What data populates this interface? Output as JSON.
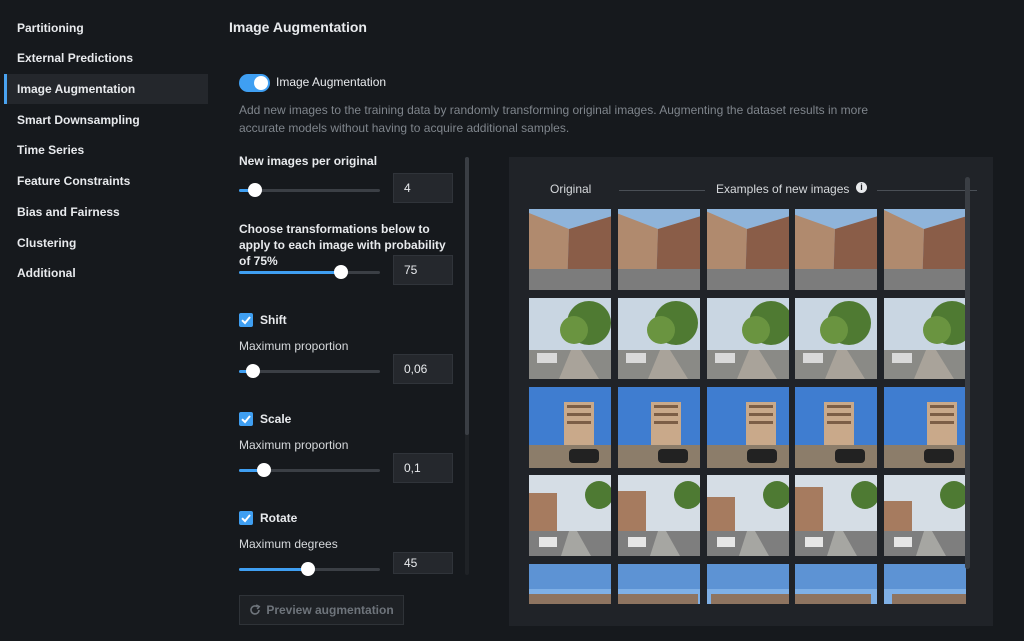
{
  "sidebar": {
    "items": [
      {
        "label": "Partitioning"
      },
      {
        "label": "External Predictions"
      },
      {
        "label": "Image Augmentation",
        "active": true
      },
      {
        "label": "Smart Downsampling"
      },
      {
        "label": "Time Series"
      },
      {
        "label": "Feature Constraints"
      },
      {
        "label": "Bias and Fairness"
      },
      {
        "label": "Clustering"
      },
      {
        "label": "Additional"
      }
    ]
  },
  "main": {
    "title": "Image Augmentation",
    "toggle": {
      "label": "Image Augmentation",
      "on": true
    },
    "description": "Add new images to the training data by randomly transforming original images. Augmenting the dataset results in more accurate models without having to acquire additional samples.",
    "new_images": {
      "label": "New images per original",
      "value": "4",
      "slider_fraction": 0.11
    },
    "probability": {
      "label": "Choose transformations below to apply to each image with probability of 75%",
      "value": "75",
      "slider_fraction": 0.72
    },
    "shift": {
      "label": "Shift",
      "checked": true,
      "sub_label": "Maximum proportion",
      "value": "0,06",
      "slider_fraction": 0.1
    },
    "scale": {
      "label": "Scale",
      "checked": true,
      "sub_label": "Maximum proportion",
      "value": "0,1",
      "slider_fraction": 0.18
    },
    "rotate": {
      "label": "Rotate",
      "checked": true,
      "sub_label": "Maximum degrees",
      "value": "45",
      "slider_fraction": 0.49
    },
    "preview_button": "Preview augmentation"
  },
  "preview": {
    "original_header": "Original",
    "examples_header": "Examples of new images",
    "info_icon": "info-icon",
    "rows": [
      "building-corner",
      "tree-street",
      "apartment-tower",
      "street-buildings",
      "sky-buildings"
    ]
  },
  "colors": {
    "accent": "#3f9ff2",
    "background": "#16191d",
    "panel": "#202328"
  }
}
